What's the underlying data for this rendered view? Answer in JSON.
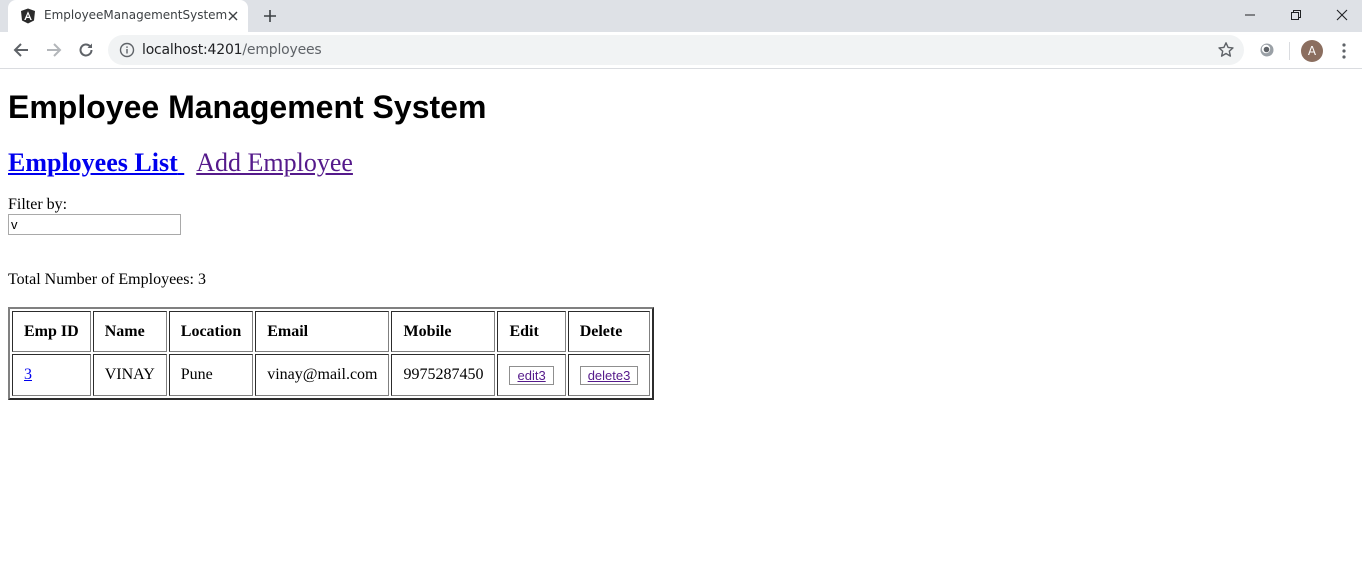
{
  "browser": {
    "tab_title": "EmployeeManagementSystem",
    "url_host": "localhost:4201",
    "url_path": "/employees",
    "profile_initial": "A"
  },
  "page": {
    "heading": "Employee Management System",
    "nav": {
      "employees_list": "Employees List",
      "add_employee": "Add Employee"
    },
    "filter": {
      "label": "Filter by:",
      "value": "v"
    },
    "total_label": "Total Number of Employees: 3",
    "table": {
      "headers": [
        "Emp ID",
        "Name",
        "Location",
        "Email",
        "Mobile",
        "Edit",
        "Delete"
      ],
      "rows": [
        {
          "emp_id": "3",
          "name": "VINAY",
          "location": "Pune",
          "email": "vinay@mail.com",
          "mobile": "9975287450",
          "edit": "edit3",
          "delete": "delete3"
        }
      ]
    }
  },
  "colors": {
    "tabstrip": "#dee1e6",
    "link": "#0000ee",
    "visited_link": "#551a8b",
    "avatar": "#8b6e5f"
  }
}
